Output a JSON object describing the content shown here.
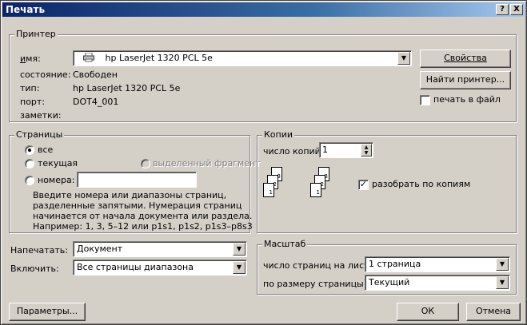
{
  "window": {
    "title": "Печать",
    "help_btn": "?",
    "close_btn": "X"
  },
  "printer": {
    "group_label": "Принтер",
    "name_label": "имя:",
    "name_value": "hp LaserJet 1320 PCL 5e",
    "properties_button": "Свойства",
    "status_label": "состояние:",
    "status_value": "Свободен",
    "type_label": "тип:",
    "type_value": "hp LaserJet 1320 PCL 5e",
    "port_label": "порт:",
    "port_value": "DOT4_001",
    "notes_label": "заметки:",
    "find_printer_button": "Найти принтер...",
    "print_to_file_label": "печать в файл",
    "print_to_file_checked": false
  },
  "pages": {
    "group_label": "Страницы",
    "all_label": "все",
    "current_label": "текущая",
    "selection_label": "выделенный фрагмент",
    "numbers_label": "номера:",
    "numbers_value": "",
    "selected": "all",
    "hint_line1": "Введите номера или диапазоны страниц,",
    "hint_line2": "разделенные запятыми. Нумерация страниц",
    "hint_line3": "начинается от начала документа или раздела.",
    "hint_line4": "Например: 1, 3, 5–12 или p1s1, p1s2, p1s3–p8s3"
  },
  "copies": {
    "group_label": "Копии",
    "count_label": "число копий:",
    "count_value": "1",
    "collate_label": "разобрать по копиям",
    "collate_checked": true,
    "page_numbers": [
      "3",
      "2",
      "1"
    ]
  },
  "print_what": {
    "label": "Напечатать:",
    "value": "Документ"
  },
  "include": {
    "label": "Включить:",
    "value": "Все страницы диапазона"
  },
  "zoom": {
    "group_label": "Масштаб",
    "pages_per_sheet_label": "число страниц на листе:",
    "pages_per_sheet_value": "1 страница",
    "scale_to_label": "по размеру страницы:",
    "scale_to_value": "Текущий"
  },
  "buttons": {
    "options": "Параметры...",
    "ok": "ОК",
    "cancel": "Отмена"
  },
  "colors": {
    "face": "#d4d0c8",
    "title_start": "#0a246a",
    "title_end": "#a6caf0"
  }
}
